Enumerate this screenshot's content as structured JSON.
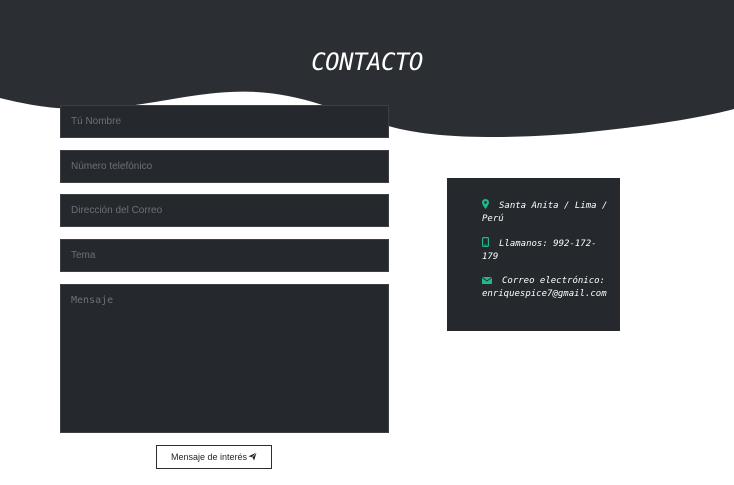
{
  "header": {
    "title": "CONTACTO"
  },
  "form": {
    "name_placeholder": "Tú Nombre",
    "phone_placeholder": "Número telefónico",
    "email_placeholder": "Dirección del Correo",
    "subject_placeholder": "Tema",
    "message_placeholder": "Mensaje",
    "submit_label": "Mensaje de interés",
    "submit_icon": "paper-plane-icon"
  },
  "contact_info": {
    "address": "Santa Anita / Lima / Perú",
    "address_icon": "map-marker-icon",
    "phone": "Llamanos: 992-172-179",
    "phone_icon": "mobile-phone-icon",
    "email": "Correo electrónico: enriquespice7@gmail.com",
    "email_icon": "envelope-icon"
  },
  "colors": {
    "header_background": "#2b2e33",
    "field_background": "#25282c",
    "icon_accent": "#1fb98f",
    "page_background": "#ffffff"
  }
}
